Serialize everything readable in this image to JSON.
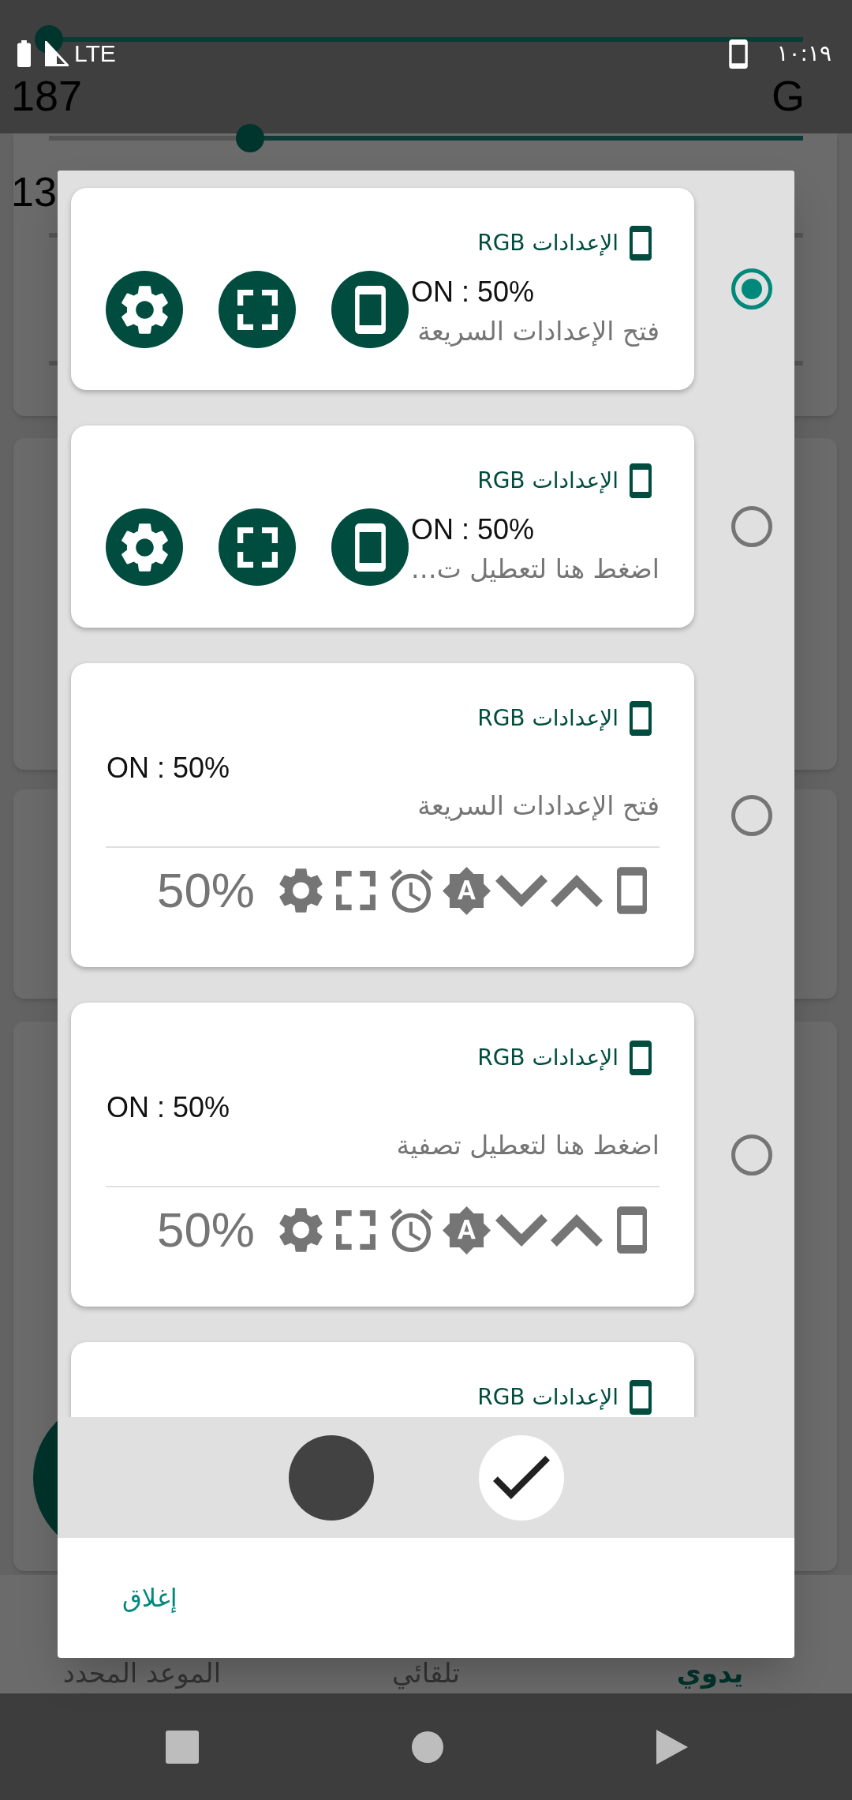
{
  "status_bar": {
    "network": "LTE",
    "time": "١٠:١٩"
  },
  "background": {
    "channels": [
      {
        "level": 1
      },
      {
        "value": "187",
        "label": "G",
        "level": 0.733
      }
    ],
    "partial_value": "13",
    "nav_tabs": [
      {
        "label": "يدوي",
        "selected": true
      },
      {
        "label": "تلقائي",
        "selected": false
      },
      {
        "label": "الموعد المحدد",
        "selected": false
      }
    ]
  },
  "dialog": {
    "options": [
      {
        "kind": "compact",
        "selected": true,
        "title": "الإعدادات RGB",
        "status": "ON : 50%",
        "subtitle": "فتح الإعدادات السريعة"
      },
      {
        "kind": "compact",
        "selected": false,
        "title": "الإعدادات RGB",
        "status": "ON : 50%",
        "subtitle": "اضغط هنا لتعطيل ت…"
      },
      {
        "kind": "expanded",
        "selected": false,
        "title": "الإعدادات RGB",
        "status": "ON : 50%",
        "subtitle": "فتح الإعدادات السريعة",
        "reading": "50%"
      },
      {
        "kind": "expanded",
        "selected": false,
        "title": "الإعدادات RGB",
        "status": "ON : 50%",
        "subtitle": "اضغط هنا لتعطيل تصفية",
        "reading": "50%"
      },
      {
        "kind": "expanded",
        "title": "الإعدادات RGB"
      }
    ],
    "color_choices": [
      {
        "color": "#424242",
        "selected": false
      },
      {
        "color": "#ffffff",
        "selected": true
      }
    ],
    "close_button": "إغلاق"
  }
}
